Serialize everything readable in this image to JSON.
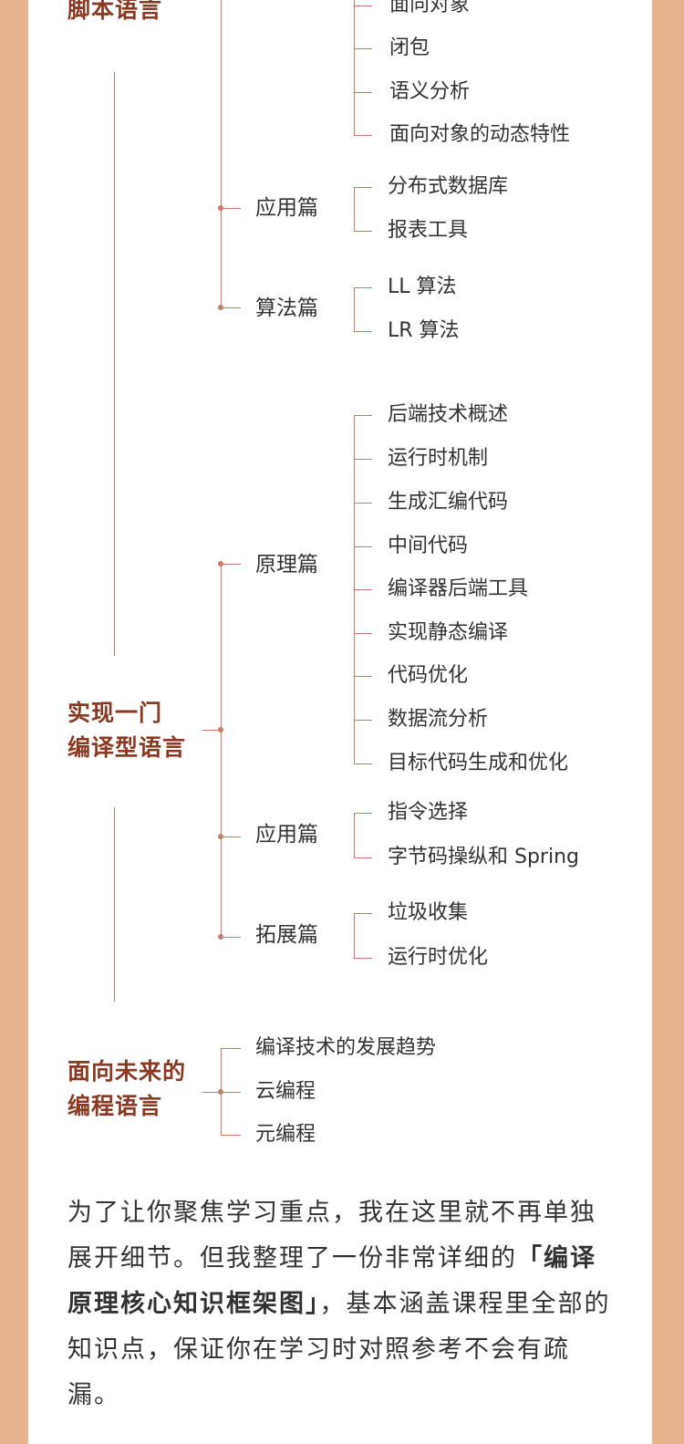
{
  "sections": {
    "script": {
      "label": "脚本语言"
    },
    "compiled": {
      "label": "实现一门\n编译型语言"
    },
    "future": {
      "label": "面向未来的\n编程语言"
    }
  },
  "script_tree": {
    "principle_items": [
      "面向对象",
      "闭包",
      "语义分析",
      "面向对象的动态特性"
    ],
    "application": {
      "label": "应用篇",
      "items": [
        "分布式数据库",
        "报表工具"
      ]
    },
    "algorithm": {
      "label": "算法篇",
      "items": [
        "LL 算法",
        "LR 算法"
      ]
    }
  },
  "compiled_tree": {
    "principle": {
      "label": "原理篇",
      "items": [
        "后端技术概述",
        "运行时机制",
        "生成汇编代码",
        "中间代码",
        "编译器后端工具",
        "实现静态编译",
        "代码优化",
        "数据流分析",
        "目标代码生成和优化"
      ]
    },
    "application": {
      "label": "应用篇",
      "items": [
        "指令选择",
        "字节码操纵和 Spring"
      ]
    },
    "extension": {
      "label": "拓展篇",
      "items": [
        "垃圾收集",
        "运行时优化"
      ]
    }
  },
  "future_tree": {
    "items": [
      "编译技术的发展趋势",
      "云编程",
      "元编程"
    ]
  },
  "paragraph": {
    "part1": "为了让你聚焦学习重点，我在这里就不再单独展开细节。但我整理了一份非常详细的",
    "bold": "「编译原理核心知识框架图」",
    "part2": "，基本涵盖课程里全部的知识点，保证你在学习时对照参考不会有疏漏。"
  },
  "colors": {
    "background": "#E6B38C",
    "card": "#FFFFFF",
    "accent": "#8A3A22",
    "line": "#C97B64",
    "text": "#333333"
  }
}
